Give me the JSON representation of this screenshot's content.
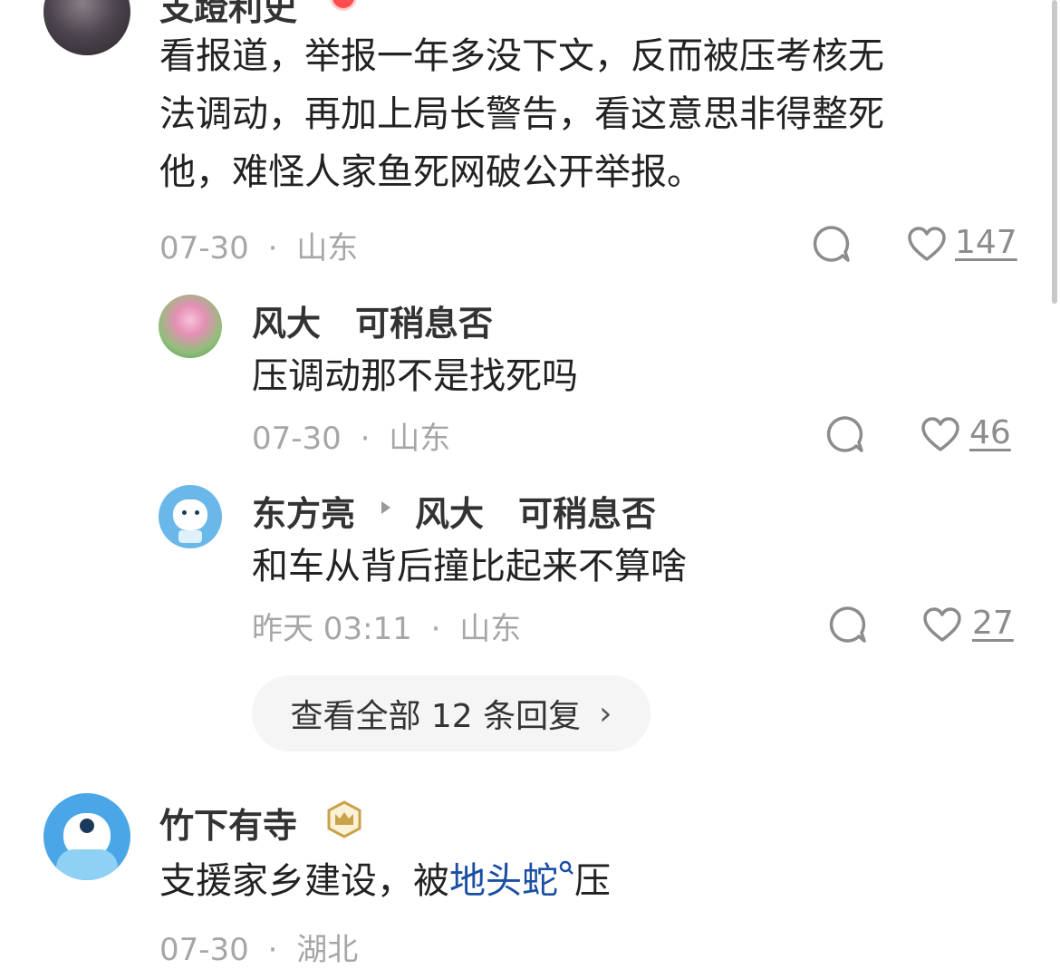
{
  "comments": [
    {
      "username": "支蹬利史",
      "content_lines": [
        "看报道，举报一年多没下文，反而被压考核无",
        "法调动，再加上局长警告，看这意思非得整死",
        "他，难怪人家鱼死网破公开举报。"
      ],
      "date": "07-30",
      "location": "山东",
      "likes": "147",
      "reply_icon": "comment-bubble-icon",
      "like_icon": "heart-icon",
      "replies": [
        {
          "username": "风大　可稍息否",
          "content": "压调动那不是找死吗",
          "date": "07-30",
          "location": "山东",
          "likes": "46"
        },
        {
          "username": "东方亮",
          "reply_to": "风大　可稍息否",
          "content": "和车从背后撞比起来不算啥",
          "date": "昨天 03:11",
          "location": "山东",
          "likes": "27"
        }
      ],
      "view_all_replies": "查看全部 12 条回复",
      "view_all_chevron": "›"
    },
    {
      "username": "竹下有寺",
      "badge_icon": "crown-badge-icon",
      "content_prefix": "支援家乡建设，被",
      "content_link": "地头蛇",
      "content_suffix": "压",
      "date": "07-30",
      "location": "湖北"
    }
  ],
  "meta_separator": "·",
  "colors": {
    "link": "#1a4fa3",
    "muted": "#a6a6a6",
    "badge": "#c9a24a"
  }
}
